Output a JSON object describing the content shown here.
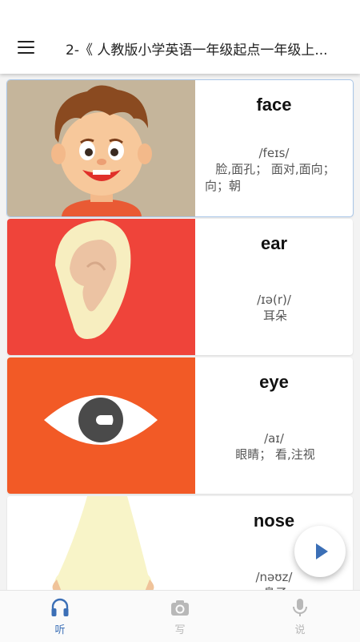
{
  "app_bar": {
    "menu_icon": "hamburger-menu-icon",
    "title": "2-《 人教版小学英语一年级起点一年级上..."
  },
  "words": [
    {
      "word": "face",
      "phonetic": "/feɪs/",
      "meaning_lines": [
        "脸,面孔； 面对,面向；",
        "向；朝"
      ],
      "image": "cartoon-boy-face-illustration",
      "selected": true
    },
    {
      "word": "ear",
      "phonetic": "/ɪə(r)/",
      "meaning_lines": [
        "耳朵"
      ],
      "image": "ear-illustration"
    },
    {
      "word": "eye",
      "phonetic": "/aɪ/",
      "meaning_lines": [
        "眼睛； 看,注视"
      ],
      "image": "eye-illustration"
    },
    {
      "word": "nose",
      "phonetic": "/nəʊz/",
      "meaning_lines": [
        "鼻子"
      ],
      "image": "nose-illustration"
    }
  ],
  "play_button": {
    "icon": "play-icon",
    "color": "#3b6fb6"
  },
  "bottom_nav": {
    "tabs": [
      {
        "label": "听",
        "icon": "headphones-icon",
        "active": true
      },
      {
        "label": "写",
        "icon": "camera-icon",
        "active": false
      },
      {
        "label": "说",
        "icon": "microphone-icon",
        "active": false
      }
    ],
    "active_color": "#3b6fb6",
    "inactive_color": "#b8b8b8"
  }
}
